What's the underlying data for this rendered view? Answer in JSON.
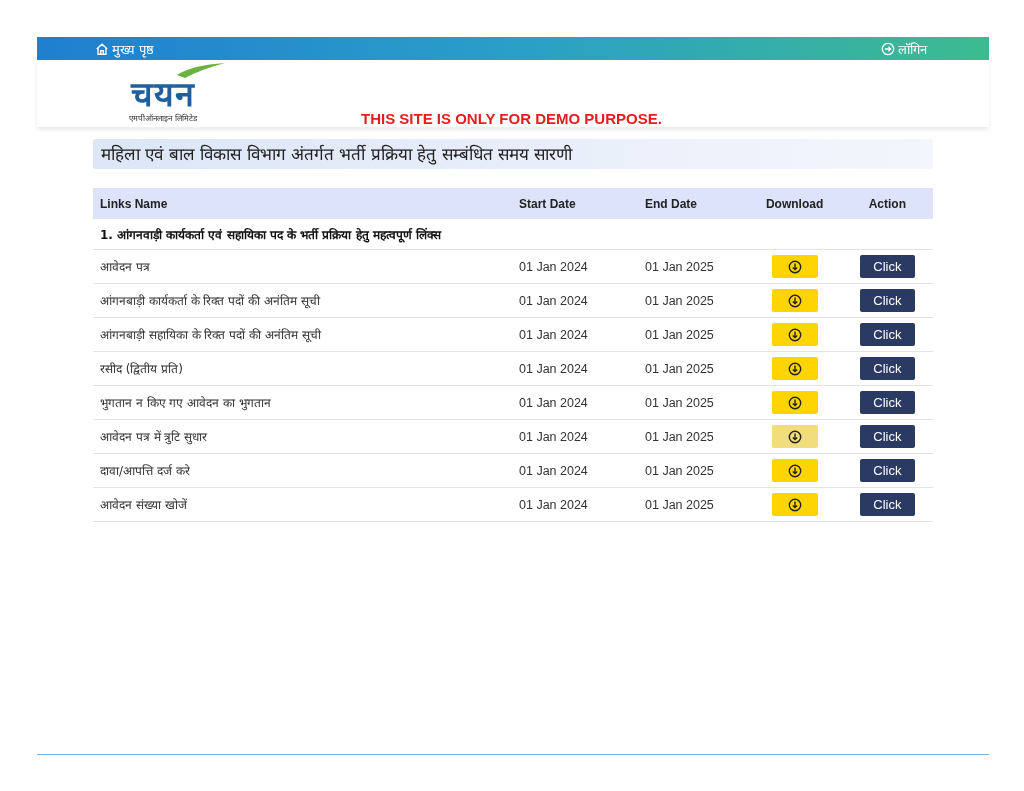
{
  "top_bar": {
    "home_link": "मुख्य पृष्ठ",
    "login_link": "लॉगिन"
  },
  "logo": {
    "wordmark": "चयन",
    "subtitle": "एमपीऑनलाइन लिमिटेड"
  },
  "demo_notice": "THIS SITE IS ONLY FOR DEMO PURPOSE.",
  "page_title": "महिला एवं बाल विकास विभाग अंतर्गत भर्ती प्रक्रिया हेतु सम्बंधित समय सारणी",
  "table": {
    "columns": [
      "Links Name",
      "Start Date",
      "End Date",
      "Download",
      "Action"
    ],
    "section": "1. आंगनवाड़ी कार्यकर्ता एवं सहायिका पद के भर्ती प्रक्रिया हेतु महत्वपूर्ण लिंक्स",
    "rows": [
      {
        "name": "आवेदन पत्र",
        "start": "01 Jan 2024",
        "end": "01 Jan 2025",
        "download_hovered": false,
        "action": "Click"
      },
      {
        "name": "आंगनबाड़ी कार्यकर्ता के रिक्त पदों की अनंतिम सूची",
        "start": "01 Jan 2024",
        "end": "01 Jan 2025",
        "download_hovered": false,
        "action": "Click"
      },
      {
        "name": "आंगनबाड़ी सहायिका के रिक्त पदों की अनंतिम सूची",
        "start": "01 Jan 2024",
        "end": "01 Jan 2025",
        "download_hovered": false,
        "action": "Click"
      },
      {
        "name": "रसीद (द्वितीय प्रति)",
        "start": "01 Jan 2024",
        "end": "01 Jan 2025",
        "download_hovered": false,
        "action": "Click"
      },
      {
        "name": "भुगतान न किए गए आवेदन का भुगतान",
        "start": "01 Jan 2024",
        "end": "01 Jan 2025",
        "download_hovered": false,
        "action": "Click"
      },
      {
        "name": "आवेदन पत्र में त्रुटि सुधार",
        "start": "01 Jan 2024",
        "end": "01 Jan 2025",
        "download_hovered": true,
        "action": "Click"
      },
      {
        "name": "दावा/आपत्ति दर्ज करे",
        "start": "01 Jan 2024",
        "end": "01 Jan 2025",
        "download_hovered": false,
        "action": "Click"
      },
      {
        "name": "आवेदन संख्या खोजें",
        "start": "01 Jan 2024",
        "end": "01 Jan 2025",
        "download_hovered": false,
        "action": "Click"
      }
    ]
  }
}
